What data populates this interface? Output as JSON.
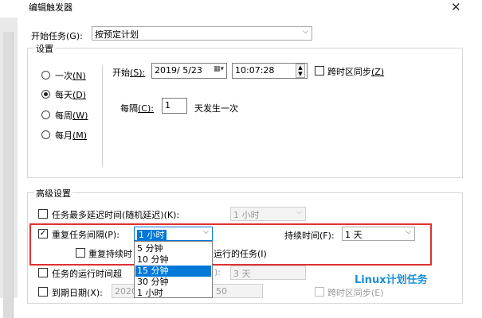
{
  "window": {
    "title": "编辑触发器"
  },
  "begin_task": {
    "label": "开始任务",
    "key": "(G):",
    "value": "按预定计划"
  },
  "settings": {
    "legend": "设置",
    "radios": [
      {
        "label": "一次",
        "key": "(N)",
        "checked": false
      },
      {
        "label": "每天",
        "key": "(D)",
        "checked": true
      },
      {
        "label": "每周",
        "key": "(W)",
        "checked": false
      },
      {
        "label": "每月",
        "key": "(M)",
        "checked": false
      }
    ],
    "start_label": "开始",
    "start_key": "(S):",
    "start_date": "2019/ 5/23",
    "start_time": "10:07:28",
    "sync_label": "跨时区同步",
    "sync_key": "(Z)",
    "recur_label": "每隔",
    "recur_key": "(C):",
    "recur_value": "1",
    "recur_suffix": "天发生一次"
  },
  "advanced": {
    "legend": "高级设置",
    "delay_label": "任务最多延迟时间(随机延迟)(K):",
    "delay_value": "1 小时",
    "repeat_label": "重复任务间隔(P):",
    "repeat_value": "1 小时",
    "duration_label": "持续时间(F):",
    "duration_value": "1 天",
    "stop_repeat_a": "重复持续时",
    "stop_repeat_b": "运行的任务(I)",
    "stop_if_label": "任务的运行时间超",
    "stop_if_tail": "):",
    "stop_if_value": "3 天",
    "expire_label": "到期日期(X):",
    "expire_date": "2020/",
    "expire_time": "50",
    "expire_sync": "跨时区同步(E)",
    "dropdown_options": [
      "5 分钟",
      "10 分钟",
      "15 分钟",
      "30 分钟",
      "1 小时"
    ],
    "dropdown_selected": 2
  },
  "watermark": "Linux计划任务",
  "colors": {
    "highlight_box": "#e03030",
    "selection": "#0078d7",
    "watermark": "#1a8fd8"
  }
}
